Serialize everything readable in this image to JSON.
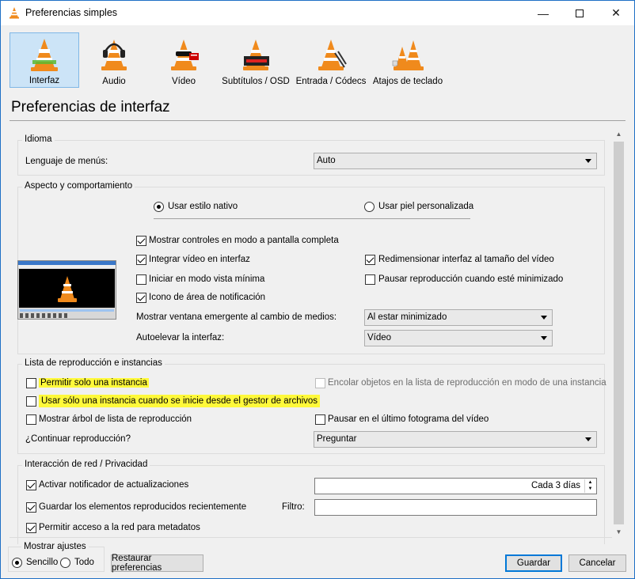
{
  "window": {
    "title": "Preferencias simples"
  },
  "categories": [
    {
      "label": "Interfaz",
      "icon": "interface-cone-icon",
      "selected": true
    },
    {
      "label": "Audio",
      "icon": "audio-cone-headphones-icon",
      "selected": false
    },
    {
      "label": "Vídeo",
      "icon": "video-cone-glasses-icon",
      "selected": false
    },
    {
      "label": "Subtítulos / OSD",
      "icon": "subtitles-cone-icon",
      "selected": false
    },
    {
      "label": "Entrada / Códecs",
      "icon": "input-codecs-cone-icon",
      "selected": false
    },
    {
      "label": "Atajos de teclado",
      "icon": "hotkeys-cones-icon",
      "selected": false
    }
  ],
  "heading": "Preferencias de interfaz",
  "idioma": {
    "group": "Idioma",
    "menu_lang_label": "Lenguaje de menús:",
    "menu_lang_value": "Auto"
  },
  "aspecto": {
    "group": "Aspecto y comportamiento",
    "native_style": "Usar estilo nativo",
    "custom_skin": "Usar piel personalizada",
    "fullscreen_controls": "Mostrar controles en modo a pantalla completa",
    "embed_video": "Integrar vídeo en interfaz",
    "resize_interface": "Redimensionar interfaz al tamaño del vídeo",
    "minimal_view": "Iniciar en modo vista mínima",
    "pause_minimized": "Pausar reproducción cuando esté minimizado",
    "systray": "Icono de área de notificación",
    "popup_label": "Mostrar ventana emergente al cambio de medios:",
    "popup_value": "Al estar minimizado",
    "autoraise_label": "Autoelevar la interfaz:",
    "autoraise_value": "Vídeo"
  },
  "playlist": {
    "group": "Lista de reproducción e instancias",
    "one_instance": "Permitir solo una instancia",
    "enqueue_one_instance": "Encolar objetos en la lista de reproducción en modo de una instancia",
    "one_instance_file_manager": "Usar sólo una instancia cuando se inicie desde el gestor de archivos",
    "playlist_tree": "Mostrar árbol de lista de reproducción",
    "pause_last_frame": "Pausar en el último fotograma del vídeo",
    "continue_label": "¿Continuar reproducción?",
    "continue_value": "Preguntar"
  },
  "network": {
    "group": "Interacción de red / Privacidad",
    "update_notifier": "Activar notificador de actualizaciones",
    "update_interval": "Cada 3 días",
    "save_recent": "Guardar los elementos reproducidos recientemente",
    "filter_label": "Filtro:",
    "filter_value": "",
    "metadata_access": "Permitir acceso a la red para metadatos"
  },
  "footer": {
    "show_settings": "Mostrar ajustes",
    "simple": "Sencillo",
    "all": "Todo",
    "reset": "Restaurar preferencias",
    "save": "Guardar",
    "cancel": "Cancelar"
  },
  "colors": {
    "highlight": "#fff93a",
    "selected_tab": "#cce4f7",
    "vlc_orange": "#f08a1c",
    "accent_blue": "#0078d7"
  }
}
